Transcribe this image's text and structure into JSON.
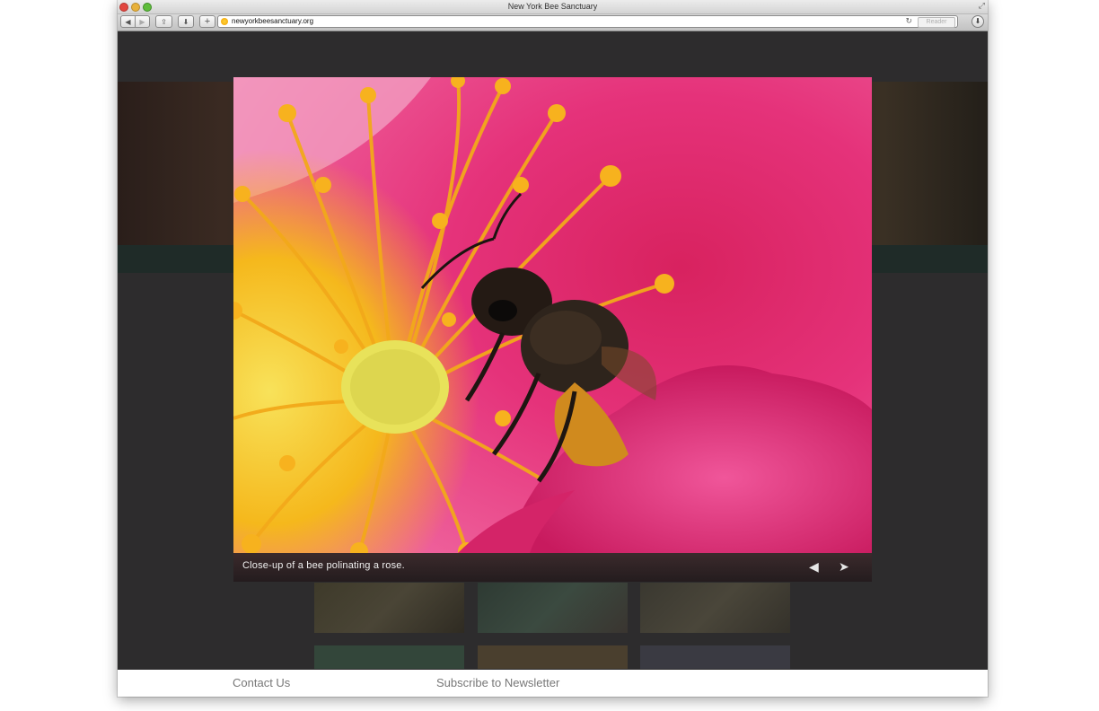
{
  "window": {
    "title": "New York Bee Sanctuary",
    "resize_icon": "resize-icon"
  },
  "toolbar": {
    "back_label": "◀",
    "forward_label": "▶",
    "share_label": "⇪",
    "download_label": "⬇",
    "newtab_label": "+",
    "url": "newyorkbeesanctuary.org",
    "reload_label": "c",
    "reader_label": "Reader",
    "downloads_label": "⬇"
  },
  "lightbox": {
    "caption": "Close-up of a bee polinating a rose.",
    "prev_label": "◀",
    "next_label": "➤"
  },
  "footer": {
    "contact": "Contact Us",
    "subscribe": "Subscribe to Newsletter"
  },
  "colors": {
    "overlay_bg": "#2d2c2d",
    "petal_pink": "#e5327a",
    "stamen_yellow": "#f5b81c",
    "footer_link": "#777777"
  }
}
